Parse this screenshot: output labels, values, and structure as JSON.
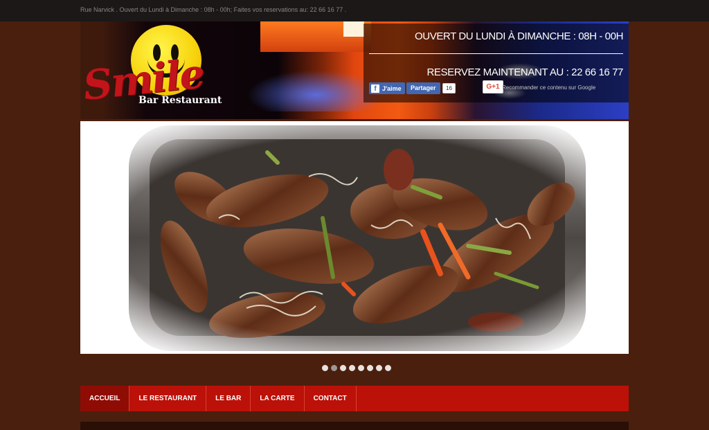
{
  "topbar": {
    "text": "Rue Narvick . Ouvert du Lundi à Dimanche : 08h - 00h; Faites vos reservations au: 22 66 16 77 ."
  },
  "header": {
    "logo_script": "Smile",
    "logo_sub": "Bar Restaurant",
    "hours": "OUVERT DU LUNDI À DIMANCHE : 08H - 00H",
    "reserve": "RESERVEZ MAINTENANT AU : 22 66 16 77"
  },
  "social": {
    "fb_icon": "f",
    "fb_like": "J'aime",
    "fb_share": "Partager",
    "fb_count": "16",
    "gplus": "G+1",
    "gplus_tip": "Recommander ce contenu sur Google"
  },
  "slider": {
    "dot_count": 8,
    "active_index": 1
  },
  "nav": {
    "items": [
      {
        "label": "ACCUEIL"
      },
      {
        "label": "LE RESTAURANT"
      },
      {
        "label": "LE BAR"
      },
      {
        "label": "LA CARTE"
      },
      {
        "label": "CONTACT"
      }
    ],
    "active_index": 0
  },
  "colors": {
    "page_bg": "#4a1f0e",
    "topbar_bg": "#1b1817",
    "nav_bg": "#bb1108",
    "nav_active": "#8f0c05",
    "logo_red": "#c2141a",
    "smiley_yellow": "#f7d20b"
  }
}
